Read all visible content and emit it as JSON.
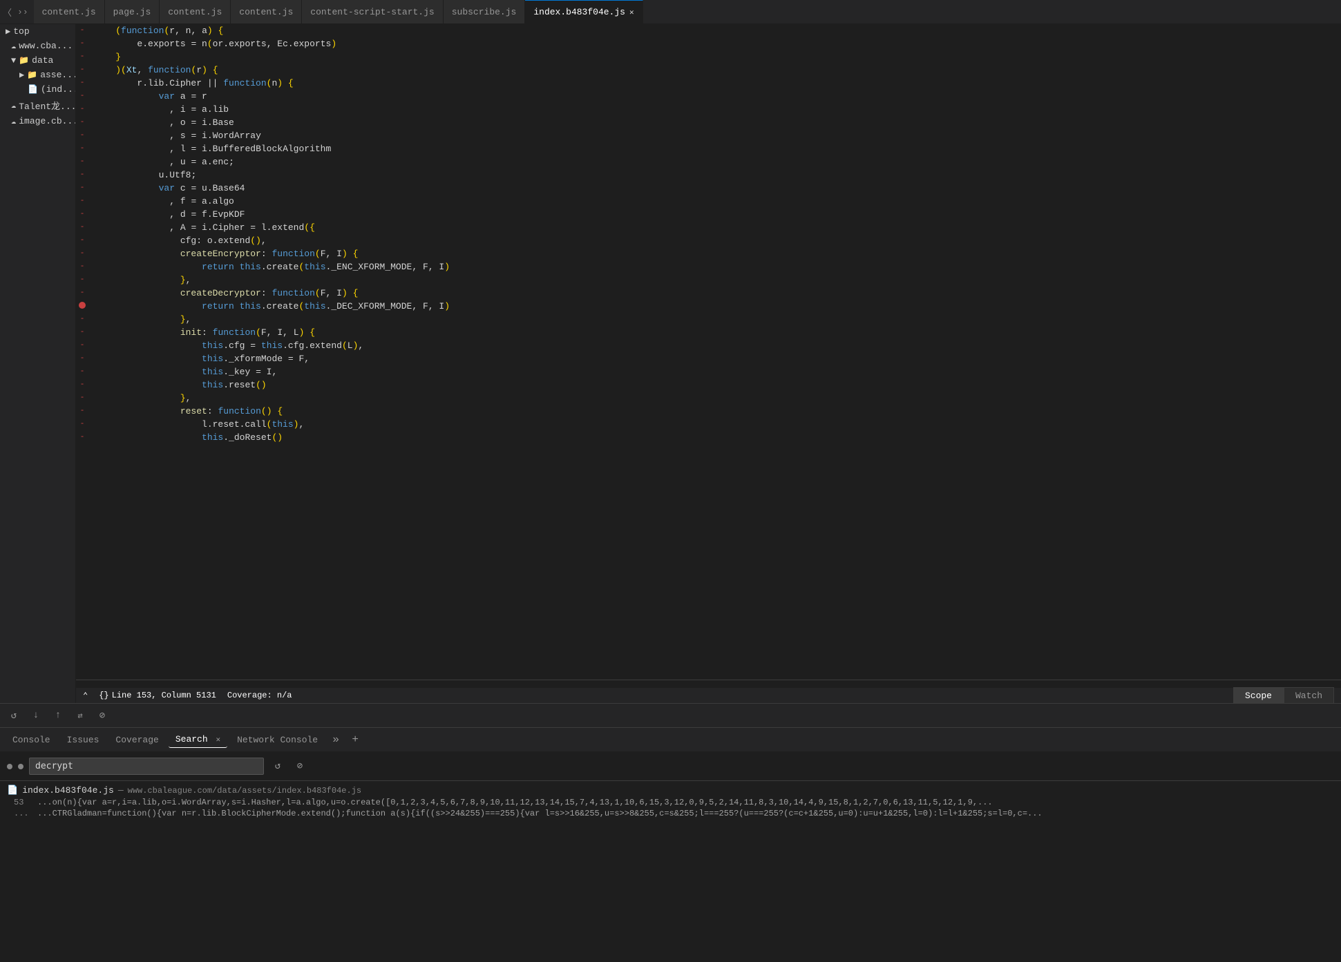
{
  "tabs": [
    {
      "label": "content.js",
      "active": false,
      "closable": false
    },
    {
      "label": "page.js",
      "active": false,
      "closable": false
    },
    {
      "label": "content.js",
      "active": false,
      "closable": false
    },
    {
      "label": "content.js",
      "active": false,
      "closable": false
    },
    {
      "label": "content-script-start.js",
      "active": false,
      "closable": false
    },
    {
      "label": "subscribe.js",
      "active": false,
      "closable": false
    },
    {
      "label": "index.b483f04e.js",
      "active": true,
      "closable": true
    }
  ],
  "sidebar": {
    "items": [
      {
        "label": "top",
        "level": 0,
        "type": "item",
        "icon": "▶"
      },
      {
        "label": "www.cba...",
        "level": 1,
        "type": "cloud"
      },
      {
        "label": "data",
        "level": 1,
        "type": "folder",
        "expanded": true
      },
      {
        "label": "asse...",
        "level": 2,
        "type": "folder"
      },
      {
        "label": "(ind...",
        "level": 3,
        "type": "file"
      },
      {
        "label": "Talent龙...",
        "level": 1,
        "type": "cloud"
      },
      {
        "label": "image.cb...",
        "level": 1,
        "type": "cloud"
      }
    ]
  },
  "code": {
    "lines": [
      {
        "num": "",
        "gutter": "-",
        "content": "    (function(r, n, a) {"
      },
      {
        "num": "",
        "gutter": "-",
        "content": "        e.exports = n(or.exports, Ec.exports)"
      },
      {
        "num": "",
        "gutter": "-",
        "content": "    }"
      },
      {
        "num": "",
        "gutter": "-",
        "content": "    )(Xt, function(r) {"
      },
      {
        "num": "",
        "gutter": "-",
        "content": "        r.lib.Cipher || function(n) {"
      },
      {
        "num": "",
        "gutter": "-",
        "content": "            var a = r"
      },
      {
        "num": "",
        "gutter": "-",
        "content": "              , i = a.lib"
      },
      {
        "num": "",
        "gutter": "-",
        "content": "              , o = i.Base"
      },
      {
        "num": "",
        "gutter": "-",
        "content": "              , s = i.WordArray"
      },
      {
        "num": "",
        "gutter": "-",
        "content": "              , l = i.BufferedBlockAlgorithm"
      },
      {
        "num": "",
        "gutter": "-",
        "content": "              , u = a.enc;"
      },
      {
        "num": "",
        "gutter": "-",
        "content": "            u.Utf8;"
      },
      {
        "num": "",
        "gutter": "-",
        "content": "            var c = u.Base64"
      },
      {
        "num": "",
        "gutter": "-",
        "content": "              , f = a.algo"
      },
      {
        "num": "",
        "gutter": "-",
        "content": "              , d = f.EvpKDF"
      },
      {
        "num": "",
        "gutter": "-",
        "content": "              , A = i.Cipher = l.extend({"
      },
      {
        "num": "",
        "gutter": "-",
        "content": "                cfg: o.extend(),"
      },
      {
        "num": "",
        "gutter": "-",
        "content": "                createEncryptor: function(F, I) {"
      },
      {
        "num": "",
        "gutter": "-",
        "content": "                    return this.create(this._ENC_XFORM_MODE, F, I)"
      },
      {
        "num": "",
        "gutter": "-",
        "content": "                },"
      },
      {
        "num": "",
        "gutter": "-",
        "content": "                createDecryptor: function(F, I) {"
      },
      {
        "num": "",
        "gutter": "bp",
        "content": "                    return this.create(this._DEC_XFORM_MODE, F, I)"
      },
      {
        "num": "",
        "gutter": "-",
        "content": "                },"
      },
      {
        "num": "",
        "gutter": "-",
        "content": "                init: function(F, I, L) {"
      },
      {
        "num": "",
        "gutter": "-",
        "content": "                    this.cfg = this.cfg.extend(L),"
      },
      {
        "num": "",
        "gutter": "-",
        "content": "                    this._xformMode = F,"
      },
      {
        "num": "",
        "gutter": "-",
        "content": "                    this._key = I,"
      },
      {
        "num": "",
        "gutter": "-",
        "content": "                    this.reset()"
      },
      {
        "num": "",
        "gutter": "-",
        "content": "                },"
      },
      {
        "num": "",
        "gutter": "-",
        "content": "                reset: function() {"
      },
      {
        "num": "",
        "gutter": "-",
        "content": "                    l.reset.call(this),"
      },
      {
        "num": "",
        "gutter": "-",
        "content": "                    this._doReset()"
      }
    ]
  },
  "status_bar": {
    "line_col": "Line 153, Column 5131",
    "coverage": "Coverage: n/a",
    "symbol_icon": "{}",
    "chevron_left": "❮",
    "expand_icon": "⌃"
  },
  "bottom_panel": {
    "tabs": [
      {
        "label": "Console",
        "active": false,
        "closable": false
      },
      {
        "label": "Issues",
        "active": false,
        "closable": false
      },
      {
        "label": "Coverage",
        "active": false,
        "closable": false
      },
      {
        "label": "Search",
        "active": true,
        "closable": true
      },
      {
        "label": "Network Console",
        "active": false,
        "closable": false
      }
    ],
    "toolbar_buttons": [
      "↺",
      "↶",
      "↷",
      "⊘"
    ],
    "scope_tab": "Scope",
    "watch_tab": "Watch",
    "search_input_value": "decrypt",
    "search_placeholder": "Search",
    "search_refresh_icon": "↺",
    "search_clear_icon": "⊘",
    "results": [
      {
        "file": "index.b483f04e.js",
        "path": "www.cbaleague.com/data/assets/index.b483f04e.js",
        "lines": [
          {
            "num": "53",
            "text": "...on(n){var a=r,i=a.lib,o=i.WordArray,s=i.Hasher,l=a.algo,u=o.create([0,1,2,3,4,5,6,7,8,9,10,11,12,13,14,15,7,4,13,1,10,6,15,3,12,0,9,5,2,14,11,8,3,10,14,4,9,15,8,1,2,7,0,6,13,11,5,12,1,9,..."
          },
          {
            "num": "...",
            "text": "...CTRGladman=function(){var n=r.lib.BlockCipherMode.extend();function a(s){if((s>>24&255)===255){var l=s>>16&255,u=s>>8&255,c=s&255;l===255?(u===255?(c=c+1&255,u=0):u=u+1&255,l=0):l=l+1&255;s=l=0,c=..."
          }
        ]
      }
    ]
  }
}
